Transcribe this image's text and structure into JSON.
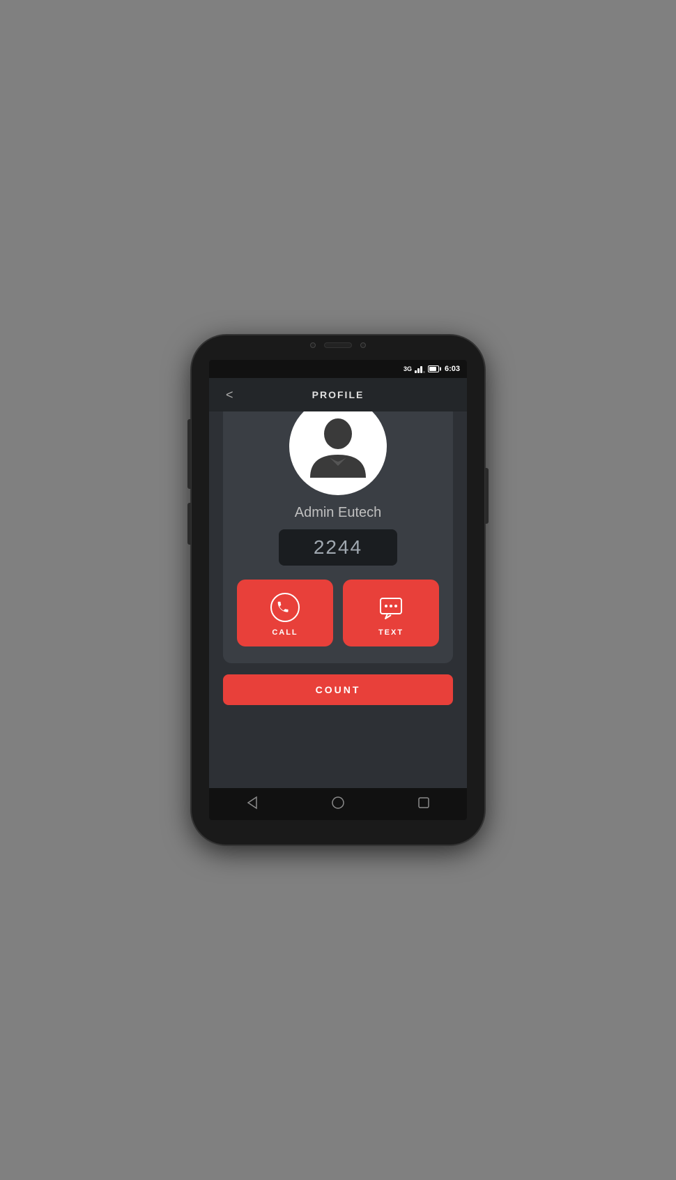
{
  "status_bar": {
    "network": "3G",
    "time": "6:03"
  },
  "header": {
    "title": "PROFILE",
    "back_label": "<"
  },
  "profile": {
    "name": "Admin Eutech",
    "extension": "2244"
  },
  "actions": {
    "call_label": "CALL",
    "text_label": "TEXT"
  },
  "count_button": {
    "label": "COUNT"
  },
  "nav": {
    "back": "◁",
    "home": "○",
    "recent": "□"
  }
}
